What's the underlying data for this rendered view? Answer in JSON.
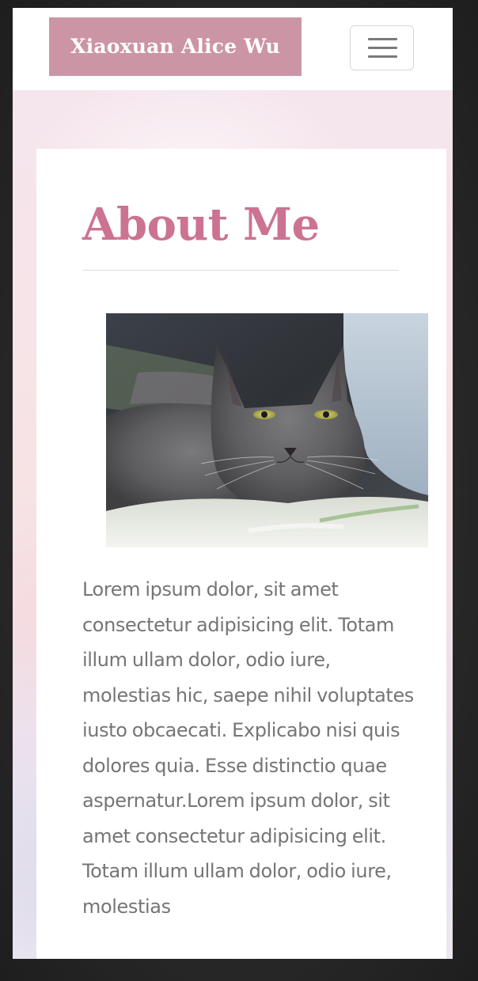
{
  "navbar": {
    "brand_label": "Xiaoxuan Alice Wu",
    "toggler_icon": "hamburger-menu-icon"
  },
  "about": {
    "title": "About Me",
    "image_icon": "cat-photo",
    "body": "Lorem ipsum dolor, sit amet consectetur adipisicing elit. Totam illum ullam dolor, odio iure, molestias hic, saepe nihil voluptates iusto obcaecati. Explicabo nisi quis dolores quia. Esse distinctio quae aspernatur.Lorem ipsum dolor, sit amet consectetur adipisicing elit. Totam illum ullam dolor, odio iure, molestias"
  },
  "colors": {
    "brand_background": "#cc95a6",
    "title_color": "#cc7391",
    "body_text_color": "#757575",
    "frame_color": "#2b2b2b"
  }
}
